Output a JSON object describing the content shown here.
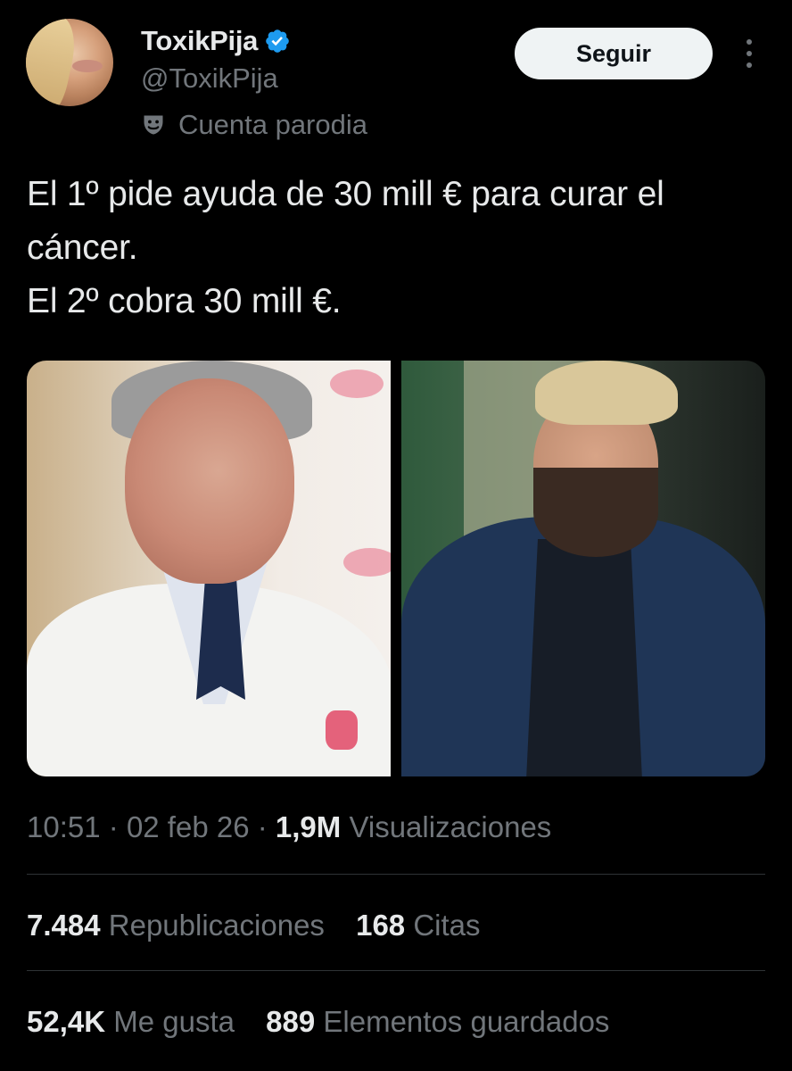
{
  "colors": {
    "background": "#000000",
    "primary_text": "#e7e9ea",
    "secondary_text": "#71767b",
    "verified_badge": "#1d9bf0",
    "divider": "#2f3336",
    "follow_button_bg": "#eff3f4",
    "follow_button_text": "#0f1419"
  },
  "author": {
    "display_name": "ToxikPija",
    "handle": "@ToxikPija",
    "verified": true,
    "verified_icon": "verified-badge-icon",
    "parody_icon": "theater-masks-icon",
    "parody_label": "Cuenta parodia",
    "avatar": "avatar-photo"
  },
  "actions": {
    "follow_label": "Seguir",
    "more_icon": "more-vertical-icon"
  },
  "tweet": {
    "lines": [
      "El 1º pide ayuda de 30 mill € para curar el",
      "cáncer.",
      "El 2º cobra 30 mill €."
    ]
  },
  "media": {
    "images": [
      {
        "name": "photo-left-doctor"
      },
      {
        "name": "photo-right-presenter"
      }
    ]
  },
  "meta": {
    "time": "10:51",
    "separator": "·",
    "date": "02 feb 26",
    "views_count": "1,9M",
    "views_label": "Visualizaciones"
  },
  "stats": {
    "reposts_count": "7.484",
    "reposts_label": "Republicaciones",
    "quotes_count": "168",
    "quotes_label": "Citas",
    "likes_count": "52,4K",
    "likes_label": "Me gusta",
    "bookmarks_count": "889",
    "bookmarks_label": "Elementos guardados"
  }
}
